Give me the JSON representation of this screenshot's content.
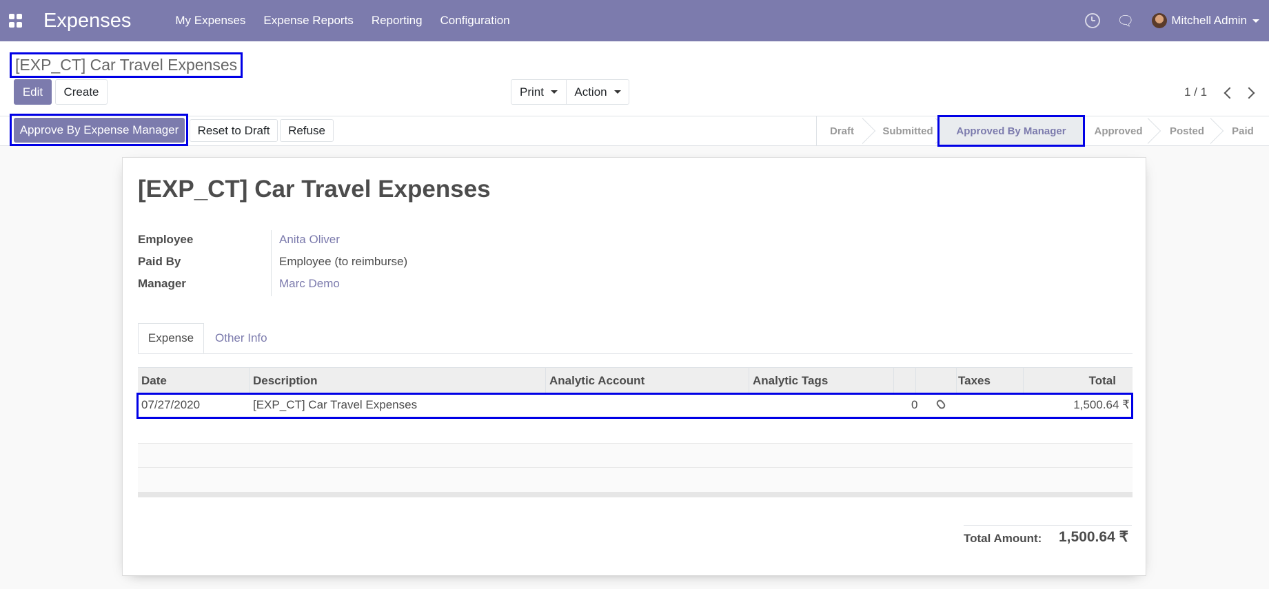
{
  "navbar": {
    "app_title": "Expenses",
    "menu": [
      "My Expenses",
      "Expense Reports",
      "Reporting",
      "Configuration"
    ],
    "user": "Mitchell Admin",
    "icons": [
      "apps-icon",
      "clock-icon",
      "chat-icon",
      "avatar"
    ],
    "bg_color": "#7c7bad"
  },
  "breadcrumb": {
    "title": "[EXP_CT] Car Travel Expenses"
  },
  "buttons": {
    "edit": "Edit",
    "create": "Create",
    "print": "Print",
    "action": "Action"
  },
  "pager": {
    "value": "1 / 1"
  },
  "statusbar": {
    "approve": "Approve By Expense Manager",
    "reset": "Reset to Draft",
    "refuse": "Refuse",
    "stages": [
      "Draft",
      "Submitted",
      "Approved By Manager",
      "Approved",
      "Posted",
      "Paid"
    ],
    "current_stage": "Approved By Manager"
  },
  "record": {
    "title": "[EXP_CT] Car Travel Expenses",
    "fields": [
      {
        "label": "Employee",
        "value": "Anita Oliver"
      },
      {
        "label": "Paid By",
        "value": "Employee (to reimburse)"
      },
      {
        "label": "Manager",
        "value": "Marc Demo"
      }
    ]
  },
  "tabs": [
    "Expense",
    "Other Info"
  ],
  "grid": {
    "columns": [
      "Date",
      "Description",
      "Analytic Account",
      "Analytic Tags",
      "Taxes",
      "Total"
    ],
    "rows": [
      {
        "date": "07/27/2020",
        "description": "[EXP_CT] Car Travel Expenses",
        "attachments": "0",
        "total": "1,500.64 ₹"
      }
    ]
  },
  "summary": {
    "label": "Total Amount:",
    "value": "1,500.64 ₹"
  }
}
